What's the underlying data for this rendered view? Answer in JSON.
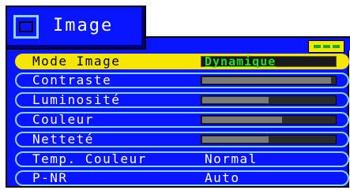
{
  "window": {
    "title": "Image",
    "title_icon": "image-menu-icon"
  },
  "indicator": {
    "color": "#f5e600",
    "dot_color": "#10b010"
  },
  "menu": {
    "items": [
      {
        "label": "Mode Image",
        "kind": "select",
        "value": "Dynamique",
        "selected": true
      },
      {
        "label": "Contraste",
        "kind": "slider",
        "level": 0.97
      },
      {
        "label": "Luminosité",
        "kind": "slider",
        "level": 0.5
      },
      {
        "label": "Couleur",
        "kind": "slider",
        "level": 0.6
      },
      {
        "label": "Netteté",
        "kind": "slider",
        "level": 0.5
      },
      {
        "label": "Temp. Couleur",
        "kind": "text",
        "value": "Normal"
      },
      {
        "label": "P-NR",
        "kind": "text",
        "value": "Auto"
      }
    ]
  },
  "colors": {
    "panel": "#0a15ff",
    "selected": "#f5e600",
    "text": "#ffffff",
    "accent_text": "#20e020"
  }
}
